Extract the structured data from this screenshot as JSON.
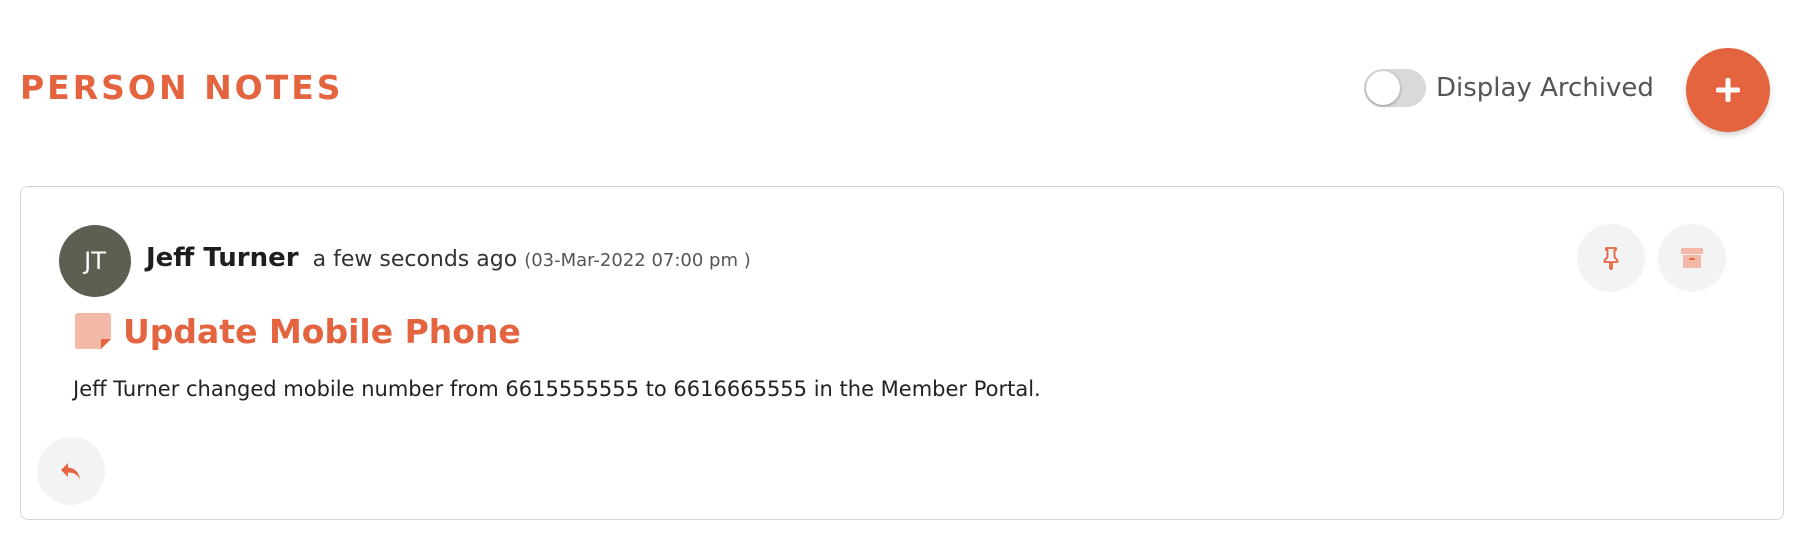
{
  "header": {
    "title": "PERSON NOTES",
    "toggle_label": "Display Archived",
    "toggle_on": false,
    "add_icon": "plus-icon"
  },
  "colors": {
    "accent": "#e4643f",
    "avatar_bg": "#5c5f52",
    "note_icon": "#f4b8a8"
  },
  "note": {
    "avatar_initials": "JT",
    "author": "Jeff Turner",
    "time_ago": "a few seconds ago",
    "timestamp": "(03-Mar-2022 07:00 pm )",
    "title": "Update Mobile Phone",
    "title_icon": "sticky-note-icon",
    "body": "Jeff Turner changed mobile number from 6615555555 to 6616665555 in the Member Portal.",
    "actions": {
      "pin_icon": "pin-icon",
      "archive_icon": "archive-icon",
      "reply_icon": "reply-icon"
    }
  }
}
